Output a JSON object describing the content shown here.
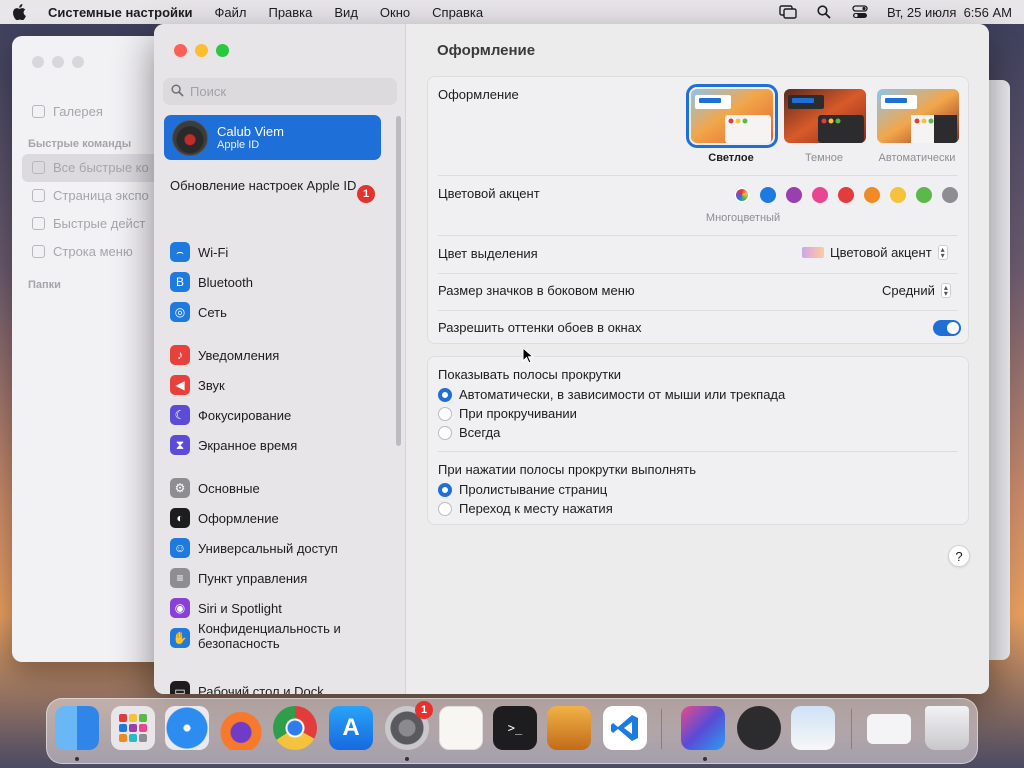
{
  "colors": {
    "accent": "#1f6fd9",
    "badge": "#e5322f"
  },
  "menubar": {
    "app": "Системные настройки",
    "menus": [
      "Файл",
      "Правка",
      "Вид",
      "Окно",
      "Справка"
    ],
    "datetime": "Вт, 25 июля  6:56 AM"
  },
  "bg_window": {
    "items": [
      "Галерея",
      "Все быстрые ко",
      "Страница экспо",
      "Быстрые дейст",
      "Строка меню"
    ],
    "section1": "Быстрые команды",
    "section2": "Папки"
  },
  "sidebar": {
    "search_placeholder": "Поиск",
    "account": {
      "name": "Calub Viem",
      "sub": "Apple ID"
    },
    "update": {
      "label": "Обновление настроек Apple ID",
      "badge": "1"
    },
    "items": [
      {
        "label": "Wi‑Fi",
        "icon": "wifi-icon",
        "color": "#1f7ae0"
      },
      {
        "label": "Bluetooth",
        "icon": "bluetooth-icon",
        "color": "#1f7ae0"
      },
      {
        "label": "Сеть",
        "icon": "globe-icon",
        "color": "#1f7ae0"
      },
      {
        "label": "Уведомления",
        "icon": "bell-icon",
        "color": "#e8403b"
      },
      {
        "label": "Звук",
        "icon": "speaker-icon",
        "color": "#e8403b"
      },
      {
        "label": "Фокусирование",
        "icon": "moon-icon",
        "color": "#5b4bd6"
      },
      {
        "label": "Экранное время",
        "icon": "hourglass-icon",
        "color": "#5b4bd6"
      },
      {
        "label": "Основные",
        "icon": "gear-icon",
        "color": "#8e8d92"
      },
      {
        "label": "Оформление",
        "icon": "appearance-icon",
        "color": "#1d1d1f"
      },
      {
        "label": "Универсальный доступ",
        "icon": "accessibility-icon",
        "color": "#1f7ae0"
      },
      {
        "label": "Пункт управления",
        "icon": "control-center-icon",
        "color": "#8e8d92"
      },
      {
        "label": "Siri и Spotlight",
        "icon": "siri-icon",
        "color": "#8a3fd6"
      },
      {
        "label": "Конфиденциальность и безопасность",
        "icon": "hand-icon",
        "color": "#1f7ae0"
      },
      {
        "label": "Рабочий стол и Dock",
        "icon": "dock-icon",
        "color": "#1d1d1f"
      }
    ]
  },
  "content": {
    "title": "Оформление",
    "appearance": {
      "label": "Оформление",
      "options": [
        "Светлое",
        "Темное",
        "Автоматически"
      ],
      "selected": "Светлое"
    },
    "accent": {
      "label": "Цветовой акцент",
      "caption": "Многоцветный",
      "colors": [
        "multicolor",
        "#1f7ae0",
        "#9a3fb0",
        "#e9468f",
        "#e23c3c",
        "#f08a24",
        "#f5c23b",
        "#5cb848",
        "#8e8d92"
      ]
    },
    "highlight": {
      "label": "Цвет выделения",
      "value": "Цветовой акцент"
    },
    "icon_size": {
      "label": "Размер значков в боковом меню",
      "value": "Средний"
    },
    "wallpaper_tint": {
      "label": "Разрешить оттенки обоев в окнах",
      "on": true
    },
    "scrollbars": {
      "label": "Показывать полосы прокрутки",
      "options": [
        "Автоматически, в зависимости от мыши или трекпада",
        "При прокручивании",
        "Всегда"
      ],
      "selected": 0
    },
    "click_scroll": {
      "label": "При нажатии полосы прокрутки выполнять",
      "options": [
        "Пролистывание страниц",
        "Переход к месту нажатия"
      ],
      "selected": 0
    },
    "help": "?"
  },
  "dock": {
    "settings_badge": "1",
    "apps": [
      "finder-icon",
      "launchpad-icon",
      "safari-icon",
      "firefox-icon",
      "chrome-icon",
      "app-store-icon",
      "system-settings-icon",
      "textedit-icon",
      "terminal-icon",
      "garageband-icon",
      "vscode-icon",
      "shortcuts-icon",
      "quicktime-icon",
      "preview-icon",
      "downloads-icon",
      "trash-icon"
    ]
  }
}
